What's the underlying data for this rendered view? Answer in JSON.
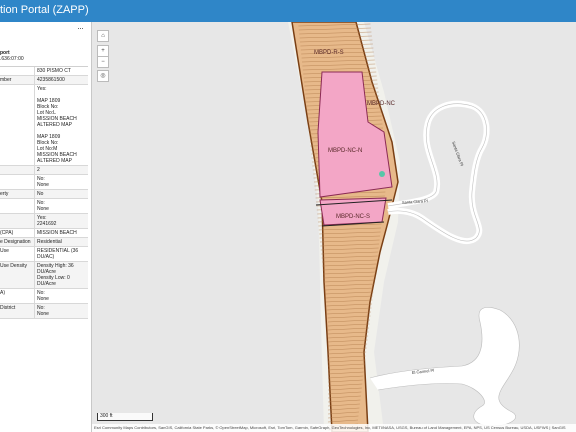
{
  "app": {
    "title": "tion Portal (ZAPP)"
  },
  "panel": {
    "more_label": "···",
    "report_label": "port",
    "report_time": ".636:07:00",
    "rows": [
      {
        "key": "",
        "value": "830 PISMO CT"
      },
      {
        "key": "mber",
        "value": "4235861500"
      },
      {
        "key": "",
        "value": "Yes:\n\nMAP 1809\nBlock No:\nLot No:L\nMISSION BEACH ALTERED MAP\n\nMAP 1809\nBlock No:\nLot No:M\nMISSION BEACH ALTERED MAP"
      },
      {
        "key": "",
        "value": "2"
      },
      {
        "key": "",
        "value": "No:\nNone"
      },
      {
        "key": "erty",
        "value": "No"
      },
      {
        "key": "",
        "value": "No:\nNone"
      },
      {
        "key": "",
        "value": "Yes:\n2241692"
      },
      {
        "key": "(CPA)",
        "value": "MISSION BEACH"
      },
      {
        "key": "e Designation",
        "value": "Residential"
      },
      {
        "key": "Use",
        "value": "RESIDENTIAL (36 DU/AC)"
      },
      {
        "key": "Use Density",
        "value": "Density High: 36 DU/Acre\nDensity Low: 0 DU/Acre"
      },
      {
        "key": "A)",
        "value": "No:\nNone"
      },
      {
        "key": "District",
        "value": "No:\nNone"
      }
    ]
  },
  "map": {
    "zone_labels": [
      "MBPD-R-S",
      "MBPD-NC",
      "MBPD-NC-N",
      "MBPD-NC-S"
    ],
    "street_labels": [
      "Santa Clara Pl",
      "Santa Clara Pl",
      "El Carmel Pl"
    ],
    "controls": {
      "home": "⌂",
      "zoom_in": "+",
      "zoom_out": "−",
      "locate": "◎"
    },
    "scale_label": "300 ft",
    "attribution": "Esri Community Maps Contributors, SanGIS, California State Parks, © OpenStreetMap, Microsoft, Esri, TomTom, Garmin, SafeGraph, GeoTechnologies, Inc, METI/NASA, USGS, Bureau of Land Management, EPA, NPS, US Census Bureau, USDA, USFWS | SanGIS"
  },
  "colors": {
    "header": "#2f86c8",
    "parcel": "#e7b98a",
    "zone_pink": "#f3a6c6",
    "map_bg": "#e7e7e7"
  }
}
